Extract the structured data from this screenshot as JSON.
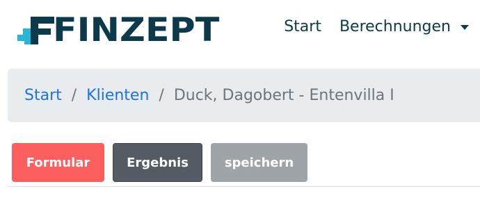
{
  "brand": {
    "name": "FINZEPT",
    "logo_icon": "finzept-stairs-logo-icon",
    "colors": {
      "dark": "#0d3a4a",
      "accent": "#27b6d7"
    }
  },
  "nav": {
    "start_label": "Start",
    "calculations_label": "Berechnungen",
    "calculations_icon": "caret-down-icon"
  },
  "breadcrumb": {
    "items": [
      {
        "label": "Start"
      },
      {
        "label": "Klienten"
      }
    ],
    "separator": "/",
    "active": "Duck, Dagobert - Entenvilla I",
    "link_color": "#1a73e8"
  },
  "actions": {
    "formular_label": "Formular",
    "ergebnis_label": "Ergebnis",
    "speichern_label": "speichern",
    "colors": {
      "formular": "#fd5f5f",
      "ergebnis": "#545b62",
      "speichern": "#9fa4a9"
    }
  }
}
